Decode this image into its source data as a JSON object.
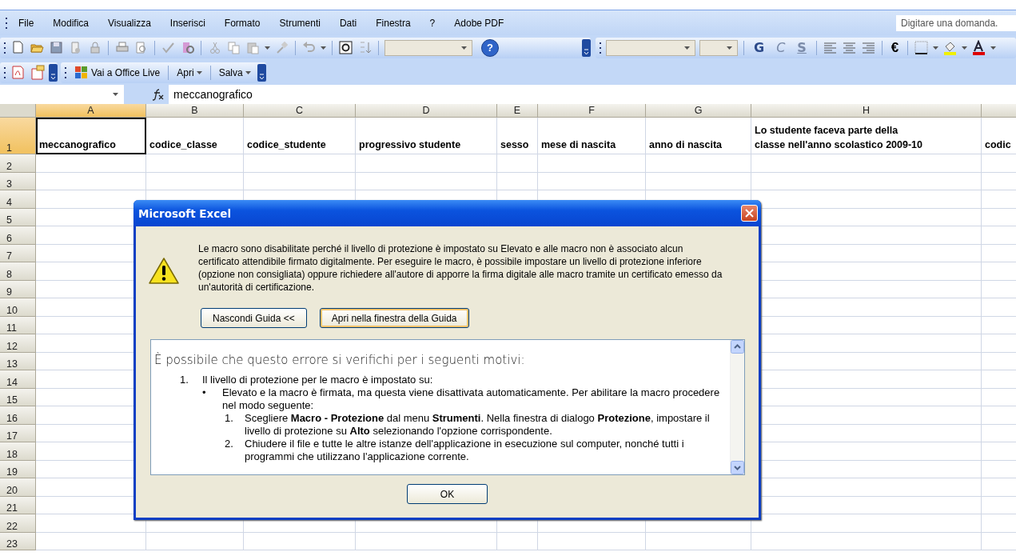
{
  "menu_bar": {
    "items": [
      "File",
      "Modifica",
      "Visualizza",
      "Inserisci",
      "Formato",
      "Strumenti",
      "Dati",
      "Finestra",
      "?",
      "Adobe PDF"
    ],
    "question_field": {
      "placeholder": "Digitare una domanda."
    }
  },
  "standard_toolbar": {
    "help_button": "?"
  },
  "format_toolbar": {
    "style_buttons": [
      "G",
      "C",
      "S"
    ],
    "currency_button": "€"
  },
  "office_live_toolbar": {
    "items": [
      {
        "label": "Vai a Office Live",
        "kind": "link"
      },
      {
        "label": "Apri",
        "kind": "menu"
      },
      {
        "label": "Salva",
        "kind": "menu"
      }
    ]
  },
  "formula_bar": {
    "value": "meccanografico"
  },
  "sheet": {
    "columns": [
      {
        "label": "A",
        "selected": true
      },
      {
        "label": "B",
        "selected": false
      },
      {
        "label": "C",
        "selected": false
      },
      {
        "label": "D",
        "selected": false
      },
      {
        "label": "E",
        "selected": false
      },
      {
        "label": "F",
        "selected": false
      },
      {
        "label": "G",
        "selected": false
      },
      {
        "label": "H",
        "selected": false
      }
    ],
    "rows": [
      {
        "label": "1",
        "selected": true,
        "cells": [
          "meccanografico",
          "codice_classe",
          "codice_studente",
          "progressivo studente",
          "sesso",
          "mese di nascita",
          "anno di nascita",
          "Lo studente faceva parte della\nclasse nell'anno scolastico 2009-10",
          "codic"
        ]
      },
      {
        "label": "2",
        "selected": false
      },
      {
        "label": "3",
        "selected": false
      },
      {
        "label": "4",
        "selected": false
      },
      {
        "label": "5",
        "selected": false
      },
      {
        "label": "6",
        "selected": false
      },
      {
        "label": "7",
        "selected": false
      },
      {
        "label": "8",
        "selected": false
      },
      {
        "label": "9",
        "selected": false
      },
      {
        "label": "10",
        "selected": false
      },
      {
        "label": "11",
        "selected": false
      },
      {
        "label": "12",
        "selected": false
      },
      {
        "label": "13",
        "selected": false
      },
      {
        "label": "14",
        "selected": false
      },
      {
        "label": "15",
        "selected": false
      },
      {
        "label": "16",
        "selected": false
      },
      {
        "label": "17",
        "selected": false
      },
      {
        "label": "18",
        "selected": false
      },
      {
        "label": "19",
        "selected": false
      },
      {
        "label": "20",
        "selected": false
      },
      {
        "label": "21",
        "selected": false
      },
      {
        "label": "22",
        "selected": false
      },
      {
        "label": "23",
        "selected": false
      }
    ]
  },
  "dialog": {
    "title": "Microsoft Excel",
    "message": "Le macro sono disabilitate perché il livello di protezione è impostato su Elevato e alle macro non è associato alcun certificato attendibile firmato digitalmente. Per eseguire le macro, è possibile impostare un livello di protezione inferiore (opzione non consigliata) oppure richiedere all'autore di apporre la firma digitale alle macro tramite un certificato emesso da un'autorità di certificazione.",
    "buttons": [
      {
        "label": "Nascondi Guida <<",
        "focused": false
      },
      {
        "label": "Apri nella finestra della Guida",
        "focused": true
      }
    ],
    "help": {
      "heading": "È possibile che questo errore si verifichi per i seguenti motivi:",
      "items": [
        {
          "marker": "1.",
          "text": "Il livello di protezione per le macro è impostato su:",
          "children": [
            {
              "marker": "•",
              "text": "Elevato e la macro è firmata, ma questa viene disattivata automaticamente. Per abilitare la macro procedere nel modo seguente:",
              "children": [
                {
                  "marker": "1.",
                  "text": "Scegliere **Macro - Protezione** dal menu **Strumenti**. Nella finestra di dialogo **Protezione**, impostare il livello di protezione su **Alto** selezionando l'opzione corrispondente."
                },
                {
                  "marker": "2.",
                  "text": "Chiudere il file e tutte le altre istanze dell'applicazione in esecuzione sul computer, nonché tutti i programmi che utilizzano l'applicazione corrente."
                }
              ]
            }
          ]
        }
      ]
    },
    "ok_button": "OK"
  }
}
